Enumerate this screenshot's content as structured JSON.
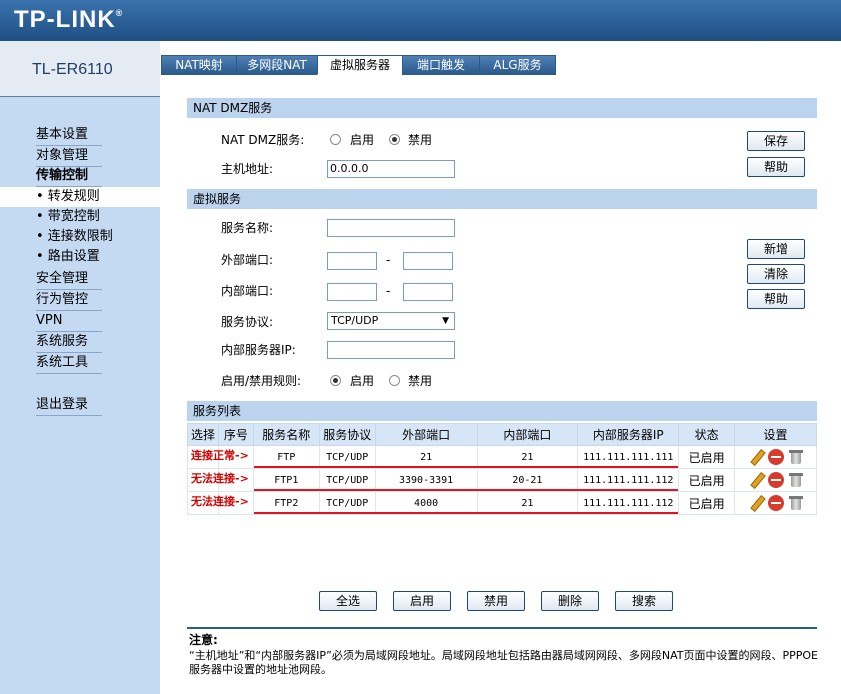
{
  "brand": {
    "logo": "TP-LINK",
    "model": "TL-ER6110"
  },
  "nav": {
    "items": [
      "基本设置",
      "对象管理",
      "传输控制"
    ],
    "sub": [
      "• 转发规则",
      "• 带宽控制",
      "• 连接数限制",
      "• 路由设置"
    ],
    "items2": [
      "安全管理",
      "行为管控",
      "VPN",
      "系统服务",
      "系统工具"
    ],
    "logout": "退出登录"
  },
  "tabs": [
    "NAT映射",
    "多网段NAT",
    "虚拟服务器",
    "端口触发",
    "ALG服务"
  ],
  "dmz": {
    "section": "NAT DMZ服务",
    "service_label": "NAT DMZ服务:",
    "enable": "启用",
    "disable": "禁用",
    "host_label": "主机地址:",
    "host_value": "0.0.0.0",
    "save": "保存",
    "help": "帮助"
  },
  "vs": {
    "section": "虚拟服务",
    "name_label": "服务名称:",
    "ext_label": "外部端口:",
    "int_label": "内部端口:",
    "dash": "-",
    "proto_label": "服务协议:",
    "proto_value": "TCP/UDP",
    "ip_label": "内部服务器IP:",
    "rule_label": "启用/禁用规则:",
    "enable": "启用",
    "disable": "禁用",
    "add": "新增",
    "clear": "清除",
    "help": "帮助"
  },
  "list": {
    "section": "服务列表",
    "headers": [
      "选择",
      "序号",
      "服务名称",
      "服务协议",
      "外部端口",
      "内部端口",
      "内部服务器IP",
      "状态",
      "设置"
    ],
    "rows": [
      {
        "name": "FTP",
        "proto": "TCP/UDP",
        "ext": "21",
        "int": "21",
        "ip": "111.111.111.111",
        "status": "已启用",
        "anno": "连接正常->"
      },
      {
        "name": "FTP1",
        "proto": "TCP/UDP",
        "ext": "3390-3391",
        "int": "20-21",
        "ip": "111.111.111.112",
        "status": "已启用",
        "anno": "无法连接->"
      },
      {
        "name": "FTP2",
        "proto": "TCP/UDP",
        "ext": "4000",
        "int": "21",
        "ip": "111.111.111.112",
        "status": "已启用",
        "anno": "无法连接->"
      }
    ],
    "icons": [
      "pencil-icon",
      "stop-icon",
      "trash-icon"
    ]
  },
  "actions": [
    "全选",
    "启用",
    "禁用",
    "删除",
    "搜索"
  ],
  "notes": {
    "title": "注意:",
    "text": "“主机地址”和“内部服务器IP”必须为局域网段地址。局域网段地址包括路由器局域网网段、多网段NAT页面中设置的网段、PPPOE服务器中设置的地址池网段。"
  },
  "colors": {
    "header": "#2a5d92",
    "sidebar": "#c4d9f2",
    "bar": "#bcd3ed",
    "annotation": "#d20000"
  }
}
